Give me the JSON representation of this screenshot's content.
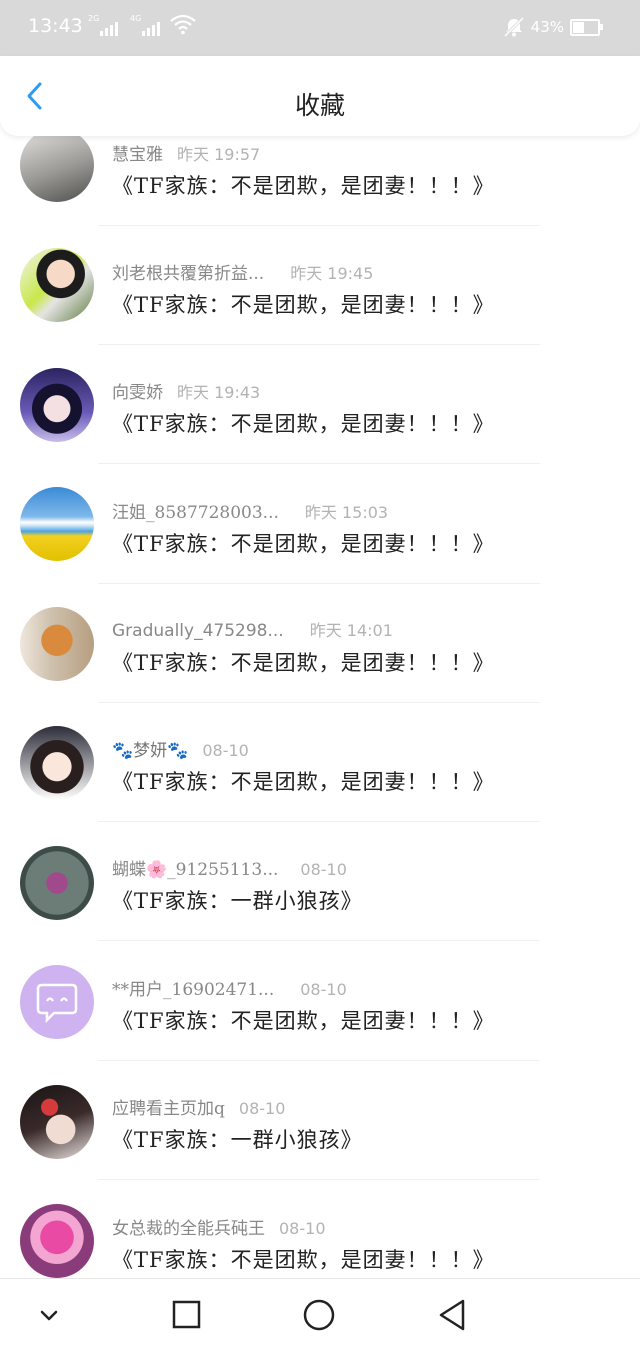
{
  "status_bar": {
    "time": "13:43",
    "sim1_tag": "2G",
    "sim2_tag": "4G",
    "battery_text": "43%",
    "battery_level": 0.43
  },
  "header": {
    "title": "收藏"
  },
  "items": [
    {
      "name": "慧宝雅",
      "time": "昨天 19:57",
      "message": "《TF家族：不是团欺，是团妻！！！》"
    },
    {
      "name": "刘老根共覆第折益...",
      "time": "昨天 19:45",
      "message": "《TF家族：不是团欺，是团妻！！！》"
    },
    {
      "name": "向雯娇",
      "time": "昨天 19:43",
      "message": "《TF家族：不是团欺，是团妻！！！》"
    },
    {
      "name": "汪姐_8587728003...",
      "time": "昨天 15:03",
      "message": "《TF家族：不是团欺，是团妻！！！》"
    },
    {
      "name": "Gradually_475298...",
      "time": "昨天 14:01",
      "message": "《TF家族：不是团欺，是团妻！！！》"
    },
    {
      "name": "🐾梦妍🐾",
      "time": "08-10",
      "message": "《TF家族：不是团欺，是团妻！！！》"
    },
    {
      "name": "蝴蝶🌸_91255113...",
      "time": "08-10",
      "message": "《TF家族：一群小狼孩》"
    },
    {
      "name": "**用户_16902471...",
      "time": "08-10",
      "message": "《TF家族：不是团欺，是团妻！！！》"
    },
    {
      "name": "应聘看主页加q",
      "time": "08-10",
      "message": "《TF家族：一群小狼孩》"
    },
    {
      "name": "女总裁的全能兵砘王",
      "time": "08-10",
      "message": "《TF家族：不是团欺，是团妻！！！》"
    }
  ],
  "colors": {
    "accent": "#2e9bf0",
    "status_bar_bg": "#d9d9d9",
    "name_text": "#888888",
    "time_text": "#b3b3b3"
  }
}
